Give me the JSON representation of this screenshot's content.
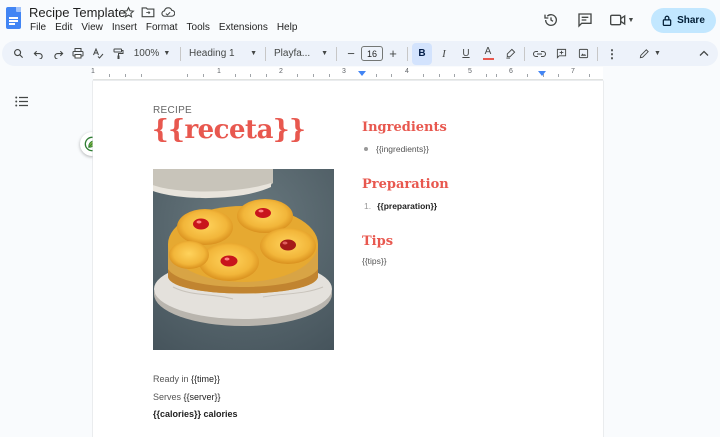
{
  "app": {
    "doc_title": "Recipe Template",
    "menu": [
      "File",
      "Edit",
      "View",
      "Insert",
      "Format",
      "Tools",
      "Extensions",
      "Help"
    ],
    "share_label": "Share"
  },
  "toolbar": {
    "zoom": "100%",
    "style": "Heading 1",
    "font": "Playfa...",
    "font_size": "16",
    "bold": "B",
    "italic": "I",
    "underline": "U",
    "text_color": "A"
  },
  "ruler": {
    "numbers": [
      "1",
      "1",
      "2",
      "3",
      "4",
      "5",
      "6",
      "7"
    ]
  },
  "document": {
    "label": "RECIPE",
    "title": "{{receta}}",
    "ready_label": "Ready in ",
    "ready_value": "{{time}}",
    "serves_label": "Serves ",
    "serves_value": "{{server}}",
    "calories": "{{calories}} calories",
    "ingredients_heading": "Ingredients",
    "ingredients_item": "{{ingredients}}",
    "preparation_heading": "Preparation",
    "preparation_number": "1.",
    "preparation_item": "{{preparation}}",
    "tips_heading": "Tips",
    "tips_body": "{{tips}}"
  },
  "colors": {
    "accent": "#e8584f",
    "share_bg": "#c2e7ff",
    "toolbar_bg": "#edf2fa"
  }
}
